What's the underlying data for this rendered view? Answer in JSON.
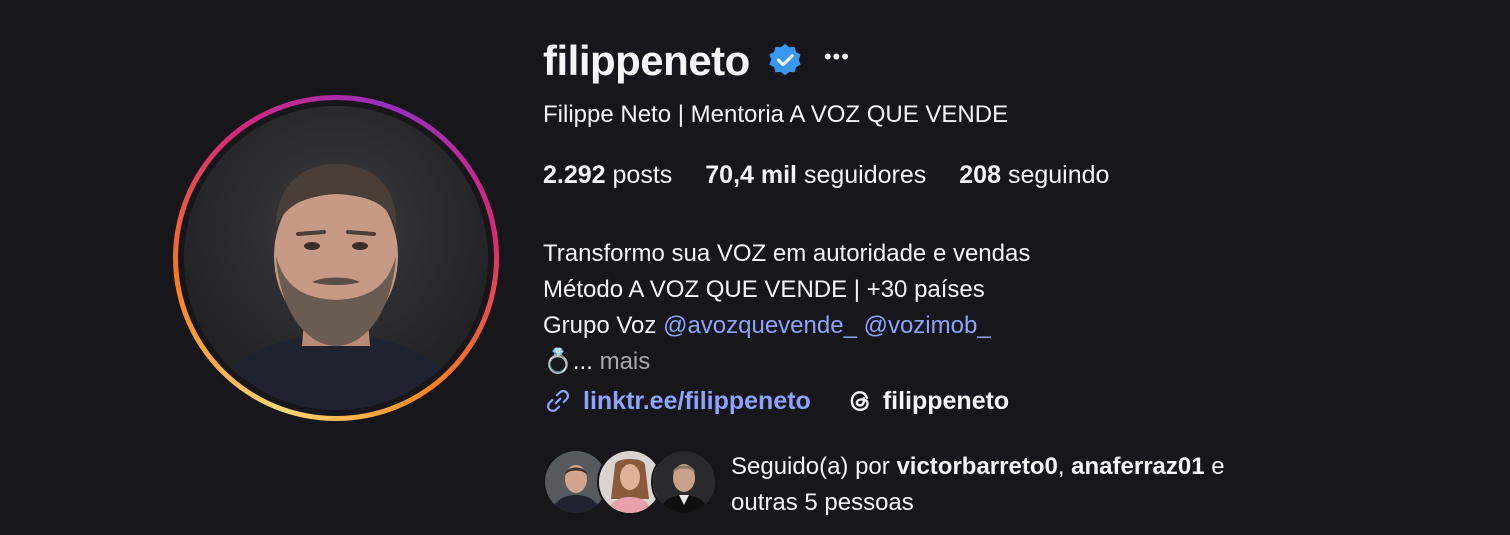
{
  "profile": {
    "username": "filippeneto",
    "full_name": "Filippe Neto | Mentoria A VOZ QUE VENDE",
    "verified": true
  },
  "stats": {
    "posts_count": "2.292",
    "posts_label": "posts",
    "followers_count": "70,4 mil",
    "followers_label": "seguidores",
    "following_count": "208",
    "following_label": "seguindo"
  },
  "bio": {
    "line1": "Transformo sua VOZ em autoridade e vendas",
    "line2": "Método A VOZ QUE VENDE | +30 países",
    "line3_prefix": "Grupo Voz",
    "mention1": "@avozquevende_",
    "mention2": "@vozimob_",
    "line4_emoji": "💍",
    "line4_ellipsis": "...",
    "more_label": "mais"
  },
  "links": {
    "website": "linktr.ee/filippeneto",
    "threads_handle": "filippeneto"
  },
  "followed_by": {
    "prefix": "Seguido(a) por",
    "user1": "victorbarreto0",
    "separator": ",",
    "user2": "anaferraz01",
    "suffix": "e",
    "line2": "outras 5 pessoas"
  },
  "colors": {
    "background": "#16161b",
    "text": "#f5f5f5",
    "link": "#8ea3ff",
    "verified_badge": "#3897f0",
    "muted": "#a8a8a8"
  }
}
